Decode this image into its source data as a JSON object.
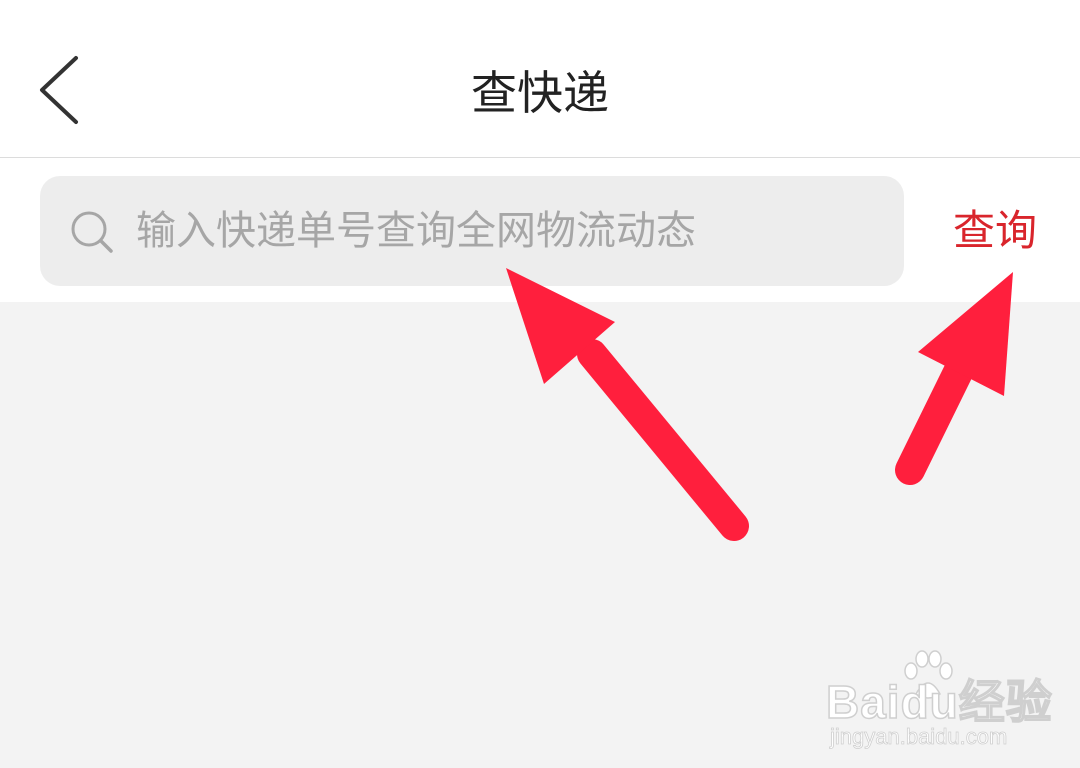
{
  "header": {
    "title": "查快递",
    "back_icon": "chevron-left-icon"
  },
  "search": {
    "placeholder": "输入快递单号查询全网物流动态",
    "value": "",
    "icon": "search-icon",
    "button_label": "查询"
  },
  "annotations": {
    "arrow_color": "#ff1f3d",
    "arrows": [
      "points-to-search-input",
      "points-to-query-button"
    ]
  },
  "watermark": {
    "logo_text": "Baidu经验",
    "url": "jingyan.baidu.com"
  },
  "colors": {
    "accent": "#d9252c",
    "background": "#f3f3f3",
    "header_bg": "#ffffff",
    "input_bg": "#ededed",
    "placeholder": "#a6a6a6",
    "title": "#222222"
  }
}
